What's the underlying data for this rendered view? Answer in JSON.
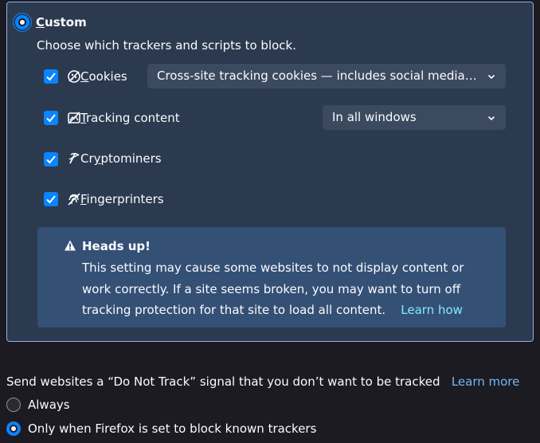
{
  "custom": {
    "label": "Custom",
    "access_key": "C",
    "label_rest": "ustom",
    "description": "Choose which trackers and scripts to block."
  },
  "trackers": [
    {
      "pre": "",
      "key": "C",
      "post": "ookies",
      "checked": true,
      "icon": "cookie-icon"
    },
    {
      "pre": "",
      "key": "T",
      "post": "racking content",
      "checked": true,
      "icon": "tracking-content-icon"
    },
    {
      "pre": "Cr",
      "key": "y",
      "post": "ptominers",
      "checked": true,
      "icon": "cryptominer-icon"
    },
    {
      "pre": "",
      "key": "F",
      "post": "ingerprinters",
      "checked": true,
      "icon": "fingerprinter-icon"
    }
  ],
  "selects": {
    "cookies": "Cross-site tracking cookies — includes social media cooki…",
    "tracking": "In all windows"
  },
  "warning": {
    "title": "Heads up!",
    "body": "This setting may cause some websites to not display content or work correctly. If a site seems broken, you may want to turn off tracking protection for that site to load all content.",
    "link": "Learn how",
    "icon": "warning-icon"
  },
  "dnt": {
    "text": "Send websites a “Do Not Track” signal that you don’t want to be tracked",
    "link": "Learn more",
    "options": [
      {
        "label": "Always",
        "selected": false
      },
      {
        "label": "Only when Firefox is set to block known trackers",
        "selected": true
      }
    ]
  },
  "colors": {
    "accent": "#0a84ff",
    "panel_bg": "#2b3a4f",
    "panel_border": "#8fb2e6",
    "warning_bg": "#355075",
    "link": "#80ebff",
    "page_bg": "#1c1b22"
  }
}
